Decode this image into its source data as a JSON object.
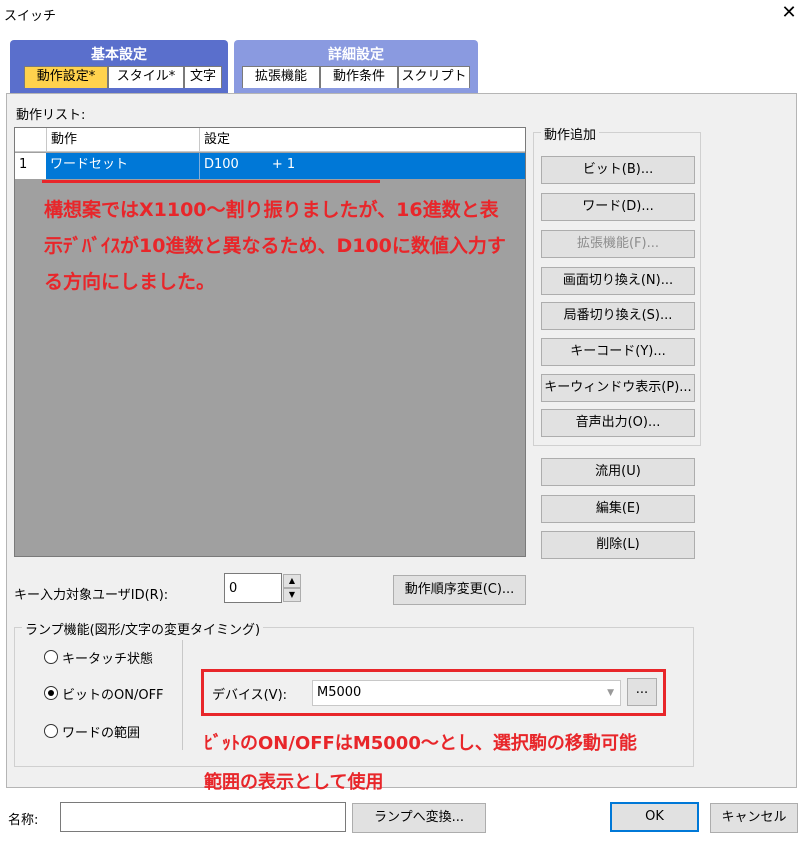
{
  "window": {
    "title": "スイッチ",
    "close_glyph": "✕"
  },
  "tabs": {
    "group1_label": "基本設定",
    "group2_label": "詳細設定",
    "items": [
      "動作設定*",
      "スタイル*",
      "文字",
      "拡張機能",
      "動作条件",
      "スクリプト"
    ],
    "active_index": 0
  },
  "action_list": {
    "label": "動作リスト:",
    "columns": [
      "動作",
      "設定"
    ],
    "rows": [
      {
        "index": "1",
        "action": "ワードセット",
        "setting": "D100        + 1"
      }
    ]
  },
  "annotations": {
    "main": "構想案ではX1100～割り振りましたが、16進数と表示ﾃﾞﾊﾞｲｽが10進数と異なるため、D100に数値入力する方向にしました。",
    "lamp": "ﾋﾞｯﾄのON/OFFはM5000～とし、選択駒の移動可能範囲の表示として使用",
    "color": "#e8262a"
  },
  "add_action": {
    "label": "動作追加",
    "buttons": [
      "ビット(B)...",
      "ワード(D)...",
      "拡張機能(F)...",
      "画面切り換え(N)...",
      "局番切り換え(S)...",
      "キーコード(Y)...",
      "キーウィンドウ表示(P)...",
      "音声出力(O)..."
    ],
    "disabled_index": 2
  },
  "edit_buttons": [
    "流用(U)",
    "編集(E)",
    "削除(L)"
  ],
  "key_input": {
    "label": "キー入力対象ユーザID(R):",
    "value": "0"
  },
  "reorder_button": "動作順序変更(C)...",
  "lamp": {
    "label": "ランプ機能(図形/文字の変更タイミング)",
    "options": [
      "キータッチ状態",
      "ビットのON/OFF",
      "ワードの範囲"
    ],
    "selected_index": 1,
    "device_label": "デバイス(V):",
    "device_value": "M5000",
    "browse_label": "..."
  },
  "footer": {
    "name_label": "名称:",
    "name_value": "",
    "convert_button": "ランプへ変換...",
    "ok": "OK",
    "cancel": "キャンセル"
  }
}
